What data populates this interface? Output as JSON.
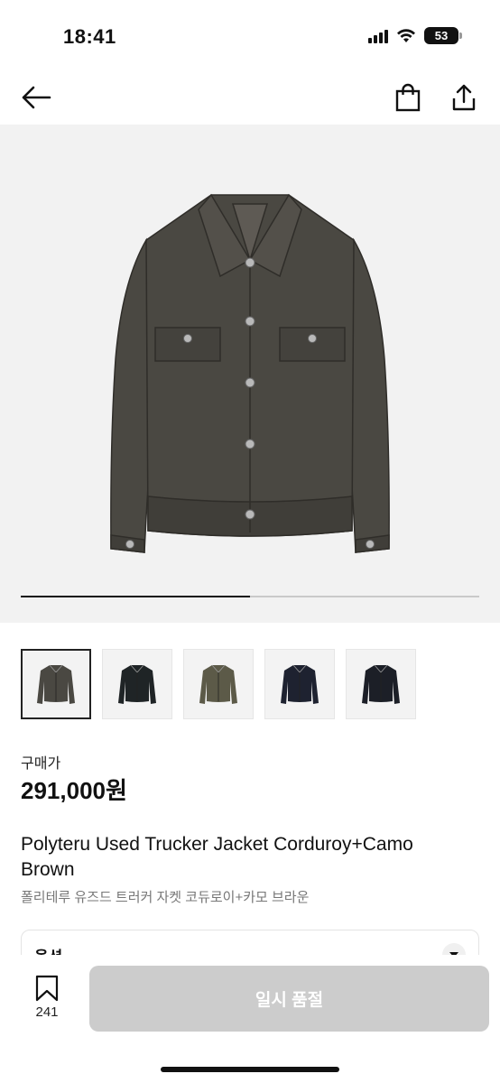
{
  "status_bar": {
    "time": "18:41",
    "battery": "53",
    "icons": [
      "signal-icon",
      "wifi-icon",
      "battery-icon"
    ]
  },
  "nav": {
    "icons": [
      "back-arrow-icon",
      "shopping-bag-icon",
      "share-icon"
    ]
  },
  "gallery": {
    "progress": 0.5,
    "thumbnails": [
      {
        "color": "#4a4842",
        "selected": true
      },
      {
        "color": "#1f2426",
        "selected": false
      },
      {
        "color": "#5c5a48",
        "selected": false
      },
      {
        "color": "#1e2230",
        "selected": false
      },
      {
        "color": "#1c1f27",
        "selected": false
      }
    ]
  },
  "product": {
    "price_label": "구매가",
    "price": "291,000원",
    "title_en": "Polyteru Used Trucker Jacket Corduroy+Camo Brown",
    "title_ko": "폴리테루 유즈드 트러커 자켓 코듀로이+카모 브라운"
  },
  "option": {
    "label": "옵션"
  },
  "bottom_bar": {
    "wish_count": "241",
    "action_label": "일시 품절",
    "action_color": "#cccccc"
  }
}
